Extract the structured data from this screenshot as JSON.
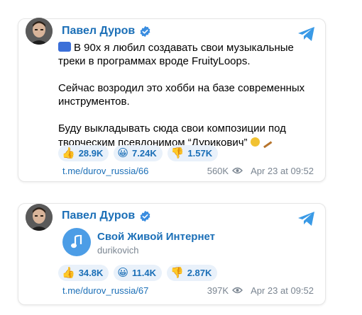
{
  "posts": [
    {
      "author": "Павел Дуров",
      "paragraphs": [
        "В 90х я любил создавать свои музыкальные треки в программах вроде FruityLoops.",
        "Сейчас возродил это хобби на базе современных инструментов.",
        "Буду выкладывать сюда свои композиции под творческим псевдонимом “Дурикович”"
      ],
      "reactions": [
        {
          "emoji": "👍",
          "count": "28.9K"
        },
        {
          "emoji": "😀",
          "count": "7.24K"
        },
        {
          "emoji": "👎",
          "count": "1.57K"
        }
      ],
      "link": "t.me/durov_russia/66",
      "views": "560K",
      "date": "Apr 23 at 09:52"
    },
    {
      "author": "Павел Дуров",
      "channel": {
        "name": "Свой Живой Интернет",
        "handle": "durikovich"
      },
      "reactions": [
        {
          "emoji": "👍",
          "count": "34.8K"
        },
        {
          "emoji": "😀",
          "count": "11.4K"
        },
        {
          "emoji": "👎",
          "count": "2.87K"
        }
      ],
      "link": "t.me/durov_russia/67",
      "views": "397K",
      "date": "Apr 23 at 09:52"
    }
  ],
  "colors": {
    "accent": "#1b6fb7",
    "reaction_bg": "#e9f1fa",
    "muted": "#7a8591"
  },
  "icons": [
    "verified-icon",
    "telegram-icon",
    "eye-icon",
    "music-note-icon",
    "sound-emoji-icon",
    "balalaika-emoji-icon"
  ]
}
